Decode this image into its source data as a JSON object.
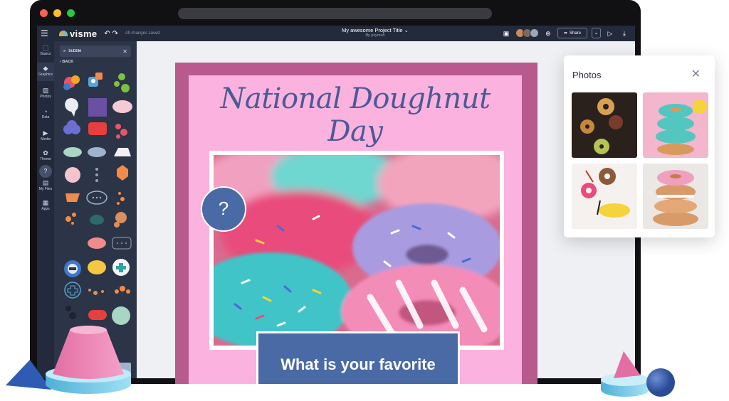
{
  "app": {
    "brand": "visme",
    "save_status": "All changes saved",
    "project_title": "My awesome Project Title",
    "project_author": "By psymon",
    "share_label": "Share"
  },
  "rail": {
    "items": [
      {
        "label": "Basics",
        "icon": "basics-icon"
      },
      {
        "label": "Graphics",
        "icon": "graphics-icon"
      },
      {
        "label": "Photos",
        "icon": "photos-icon"
      },
      {
        "label": "Data",
        "icon": "data-icon"
      },
      {
        "label": "Media",
        "icon": "media-icon"
      },
      {
        "label": "Theme",
        "icon": "theme-icon"
      },
      {
        "label": "My Files",
        "icon": "files-icon"
      },
      {
        "label": "Apps",
        "icon": "apps-icon"
      }
    ]
  },
  "panel": {
    "search_value": "bubble",
    "back_label": "BACK"
  },
  "poster": {
    "title": "National Doughnut Day",
    "question": "What is your favorite"
  },
  "photos_panel": {
    "title": "Photos"
  },
  "colors": {
    "poster_pink": "#fbb2de",
    "poster_border": "#b85a8e",
    "accent_blue": "#4a6aa6",
    "app_dark": "#232a3b"
  }
}
